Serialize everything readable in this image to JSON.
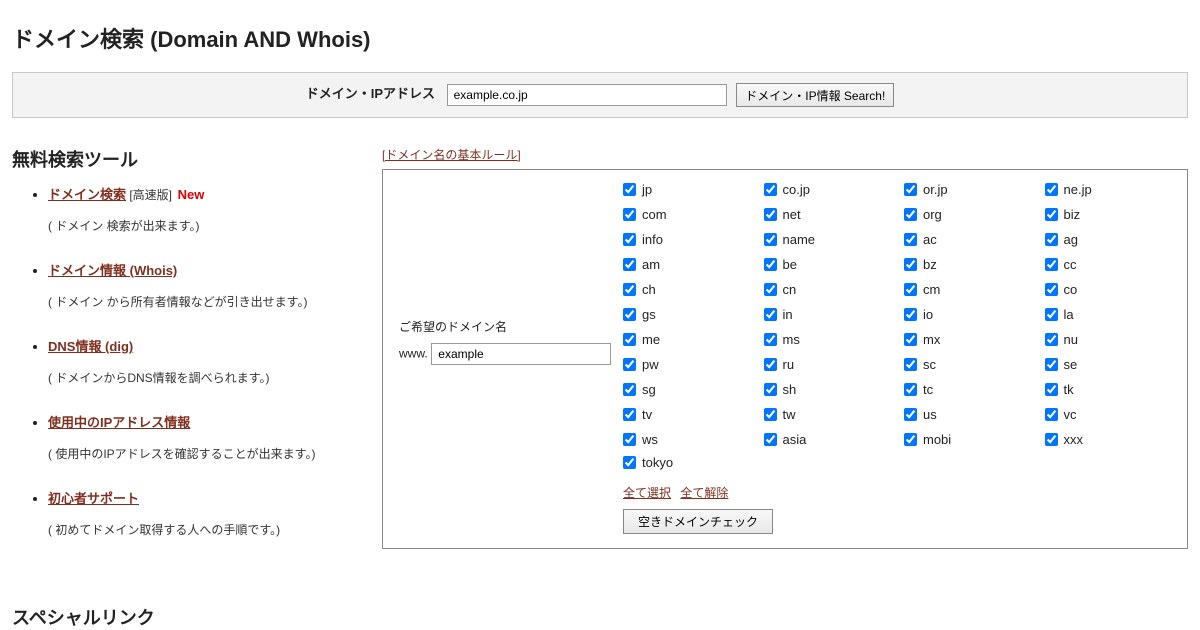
{
  "page_title": "ドメイン検索 (Domain AND Whois)",
  "searchbar": {
    "label": "ドメイン・IPアドレス",
    "value": "example.co.jp",
    "button": "ドメイン・IP情報 Search!"
  },
  "sidebar": {
    "heading": "無料検索ツール",
    "items": [
      {
        "link": "ドメイン検索",
        "suffix": " [高速版]",
        "badge": " New",
        "desc": "( ドメイン 検索が出来ます。)"
      },
      {
        "link": "ドメイン情報 (Whois)",
        "suffix": "",
        "badge": "",
        "desc": "( ドメイン から所有者情報などが引き出せます。)"
      },
      {
        "link": "DNS情報 (dig)",
        "suffix": "",
        "badge": "",
        "desc": "( ドメインからDNS情報を調べられます。)"
      },
      {
        "link": "使用中のIPアドレス情報",
        "suffix": "",
        "badge": "",
        "desc": "( 使用中のIPアドレスを確認することが出来ます。)"
      },
      {
        "link": "初心者サポート",
        "suffix": "",
        "badge": "",
        "desc": "( 初めてドメイン取得する人への手順です。)"
      }
    ]
  },
  "main": {
    "rules_link": "[ドメイン名の基本ルール]",
    "wish_label": "ご希望のドメイン名",
    "www_prefix": "www.",
    "wish_value": "example",
    "tlds": [
      "jp",
      "co.jp",
      "or.jp",
      "ne.jp",
      "com",
      "net",
      "org",
      "biz",
      "info",
      "name",
      "ac",
      "ag",
      "am",
      "be",
      "bz",
      "cc",
      "ch",
      "cn",
      "cm",
      "co",
      "gs",
      "in",
      "io",
      "la",
      "me",
      "ms",
      "mx",
      "nu",
      "pw",
      "ru",
      "sc",
      "se",
      "sg",
      "sh",
      "tc",
      "tk",
      "tv",
      "tw",
      "us",
      "vc",
      "ws",
      "asia",
      "mobi",
      "xxx"
    ],
    "tld_last": "tokyo",
    "select_all": "全て選択",
    "deselect_all": "全て解除",
    "check_button": "空きドメインチェック"
  },
  "special_heading": "スペシャルリンク"
}
